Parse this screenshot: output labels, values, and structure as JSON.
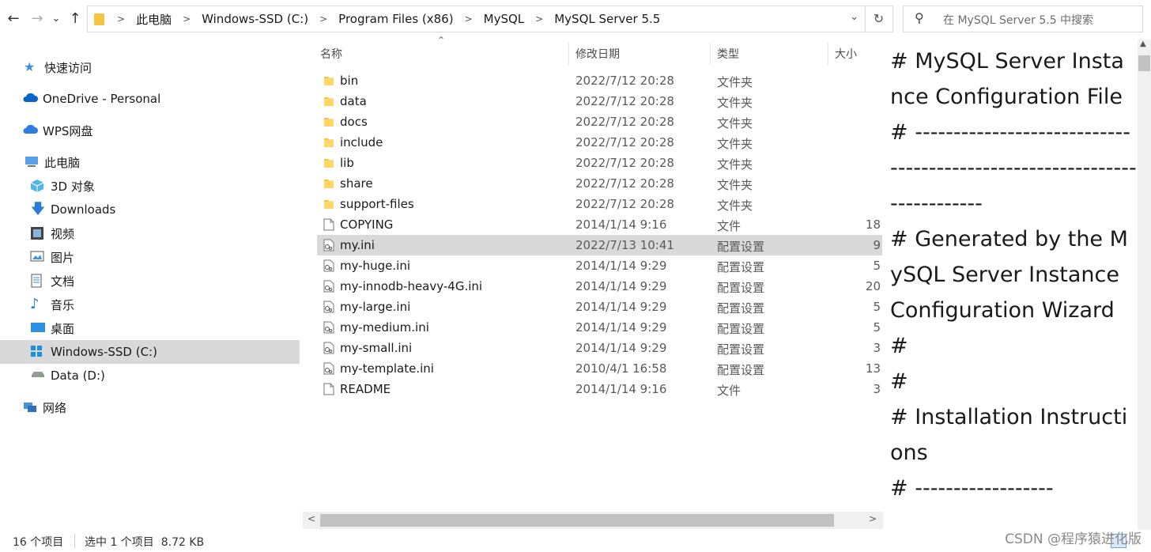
{
  "navigation": {
    "back_icon": "←",
    "forward_icon": "→",
    "recent_icon": "⌄",
    "up_icon": "↑"
  },
  "address_bar": {
    "crumbs": [
      "此电脑",
      "Windows-SSD (C:)",
      "Program Files (x86)",
      "MySQL",
      "MySQL Server 5.5"
    ],
    "refresh_icon": "↻"
  },
  "search": {
    "placeholder": "在 MySQL Server 5.5 中搜索"
  },
  "sidebar": {
    "items": [
      {
        "label": "快速访问",
        "icon": "star-icon"
      },
      {
        "label": "OneDrive - Personal",
        "icon": "cloud-icon"
      },
      {
        "label": "WPS网盘",
        "icon": "cloud-icon"
      },
      {
        "label": "此电脑",
        "icon": "computer-icon"
      },
      {
        "label": "3D 对象",
        "icon": "cube-icon"
      },
      {
        "label": "Downloads",
        "icon": "download-icon"
      },
      {
        "label": "视频",
        "icon": "film-icon"
      },
      {
        "label": "图片",
        "icon": "picture-icon"
      },
      {
        "label": "文档",
        "icon": "document-icon"
      },
      {
        "label": "音乐",
        "icon": "music-icon"
      },
      {
        "label": "桌面",
        "icon": "desktop-icon"
      },
      {
        "label": "Windows-SSD (C:)",
        "icon": "drive-icon"
      },
      {
        "label": "Data (D:)",
        "icon": "drive-icon"
      },
      {
        "label": "网络",
        "icon": "network-icon"
      }
    ],
    "selected": "Windows-SSD (C:)"
  },
  "columns": {
    "name": "名称",
    "date": "修改日期",
    "type": "类型",
    "size": "大小"
  },
  "files": [
    {
      "name": "bin",
      "date": "2022/7/12 20:28",
      "type": "文件夹",
      "size": "",
      "kind": "folder"
    },
    {
      "name": "data",
      "date": "2022/7/12 20:28",
      "type": "文件夹",
      "size": "",
      "kind": "folder"
    },
    {
      "name": "docs",
      "date": "2022/7/12 20:28",
      "type": "文件夹",
      "size": "",
      "kind": "folder"
    },
    {
      "name": "include",
      "date": "2022/7/12 20:28",
      "type": "文件夹",
      "size": "",
      "kind": "folder"
    },
    {
      "name": "lib",
      "date": "2022/7/12 20:28",
      "type": "文件夹",
      "size": "",
      "kind": "folder"
    },
    {
      "name": "share",
      "date": "2022/7/12 20:28",
      "type": "文件夹",
      "size": "",
      "kind": "folder"
    },
    {
      "name": "support-files",
      "date": "2022/7/12 20:28",
      "type": "文件夹",
      "size": "",
      "kind": "folder"
    },
    {
      "name": "COPYING",
      "date": "2014/1/14 9:16",
      "type": "文件",
      "size": "18",
      "kind": "file"
    },
    {
      "name": "my.ini",
      "date": "2022/7/13 10:41",
      "type": "配置设置",
      "size": "9",
      "kind": "ini",
      "selected": true
    },
    {
      "name": "my-huge.ini",
      "date": "2014/1/14 9:29",
      "type": "配置设置",
      "size": "5",
      "kind": "ini"
    },
    {
      "name": "my-innodb-heavy-4G.ini",
      "date": "2014/1/14 9:29",
      "type": "配置设置",
      "size": "20",
      "kind": "ini"
    },
    {
      "name": "my-large.ini",
      "date": "2014/1/14 9:29",
      "type": "配置设置",
      "size": "5",
      "kind": "ini"
    },
    {
      "name": "my-medium.ini",
      "date": "2014/1/14 9:29",
      "type": "配置设置",
      "size": "5",
      "kind": "ini"
    },
    {
      "name": "my-small.ini",
      "date": "2014/1/14 9:29",
      "type": "配置设置",
      "size": "3",
      "kind": "ini"
    },
    {
      "name": "my-template.ini",
      "date": "2010/4/1 16:58",
      "type": "配置设置",
      "size": "13",
      "kind": "ini"
    },
    {
      "name": "README",
      "date": "2014/1/14 9:16",
      "type": "文件",
      "size": "3",
      "kind": "file"
    }
  ],
  "preview": {
    "text": "# MySQL Server Instance Configuration File\n# ------------------------------------------------------------------------\n# Generated by the MySQL Server Instance Configuration Wizard\n#\n#\n# Installation Instructions\n# ------------------"
  },
  "status": {
    "item_count": "16 个项目",
    "selection": "选中 1 个项目  8.72 KB"
  },
  "watermark": "CSDN @程序猿进化版",
  "colors": {
    "selection": "#d9d9d9",
    "folder": "#f5c542",
    "accent": "#0078d4"
  }
}
